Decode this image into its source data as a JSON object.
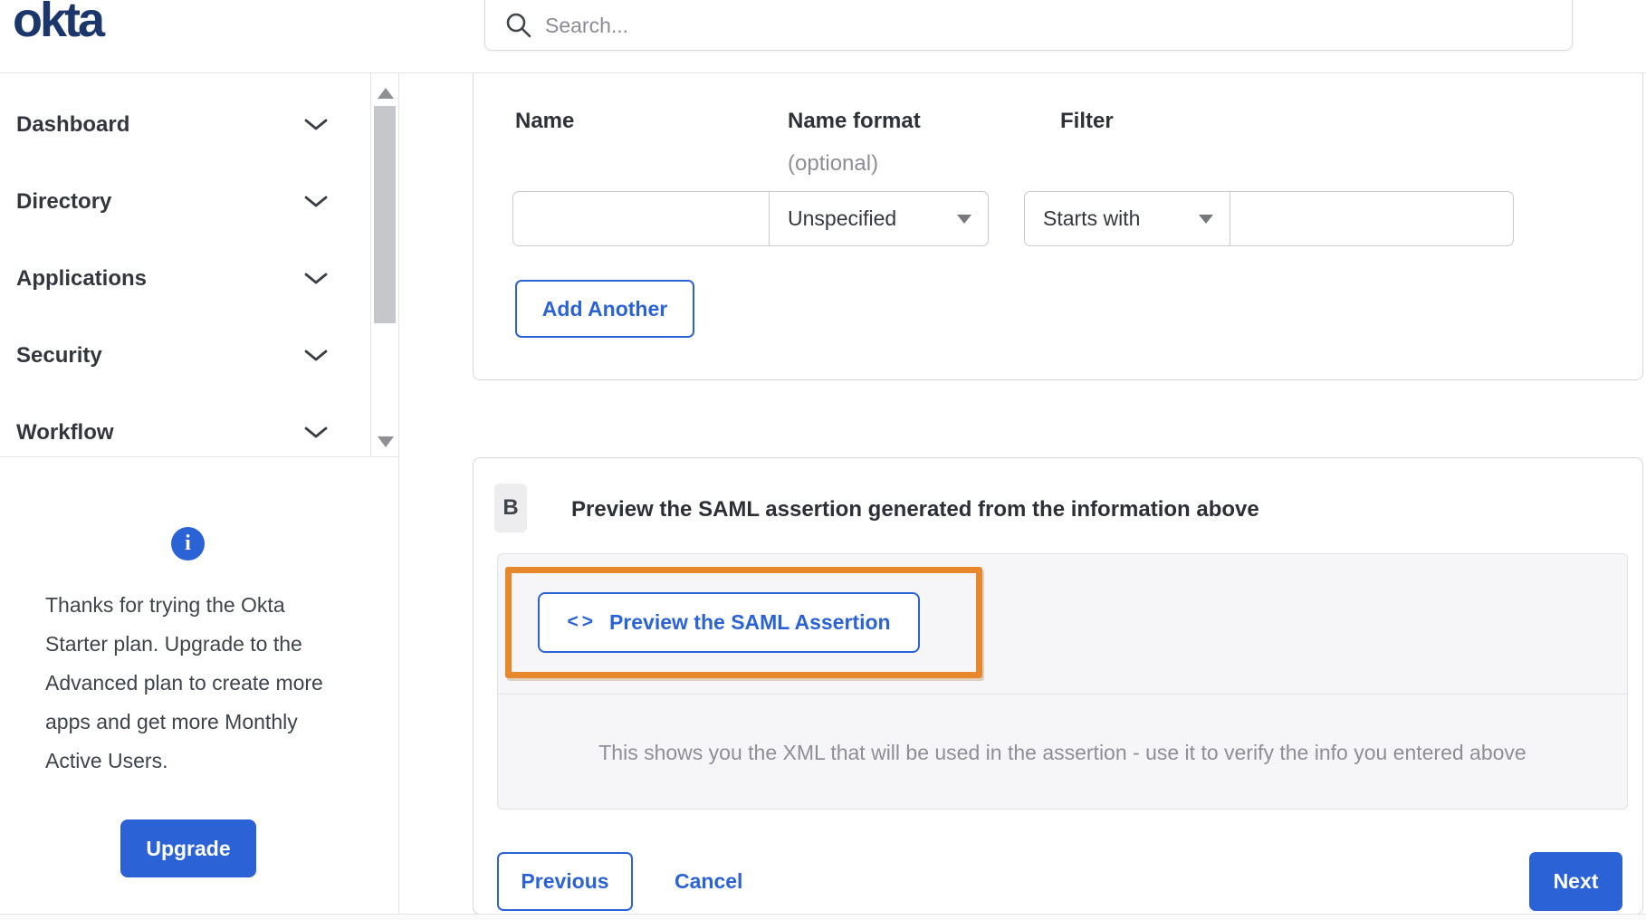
{
  "brand": {
    "logo_text": "okta"
  },
  "search": {
    "placeholder": "Search...",
    "value": ""
  },
  "sidebar": {
    "items": [
      {
        "label": "Dashboard"
      },
      {
        "label": "Directory"
      },
      {
        "label": "Applications"
      },
      {
        "label": "Security"
      },
      {
        "label": "Workflow"
      }
    ],
    "trial_note": "Thanks for trying the Okta Starter plan. Upgrade to the Advanced plan to create more apps and get more Monthly Active Users.",
    "upgrade_label": "Upgrade"
  },
  "attribute_form": {
    "columns": {
      "name": "Name",
      "name_format": "Name format",
      "name_format_hint": "(optional)",
      "filter": "Filter"
    },
    "row": {
      "name_value": "",
      "name_format_value": "Unspecified",
      "filter_operator": "Starts with",
      "filter_value": ""
    },
    "add_another_label": "Add Another"
  },
  "preview_section": {
    "badge": "B",
    "heading": "Preview the SAML assertion generated from the information above",
    "code_icon": "<>",
    "preview_button_label": "Preview the SAML Assertion",
    "description": "This shows you the XML that will be used in the assertion - use it to verify the info you entered above"
  },
  "footer": {
    "previous_label": "Previous",
    "cancel_label": "Cancel",
    "next_label": "Next"
  },
  "colors": {
    "accent_blue": "#2b63d7",
    "brand_navy": "#1a366b",
    "highlight_orange": "#e6882b"
  }
}
